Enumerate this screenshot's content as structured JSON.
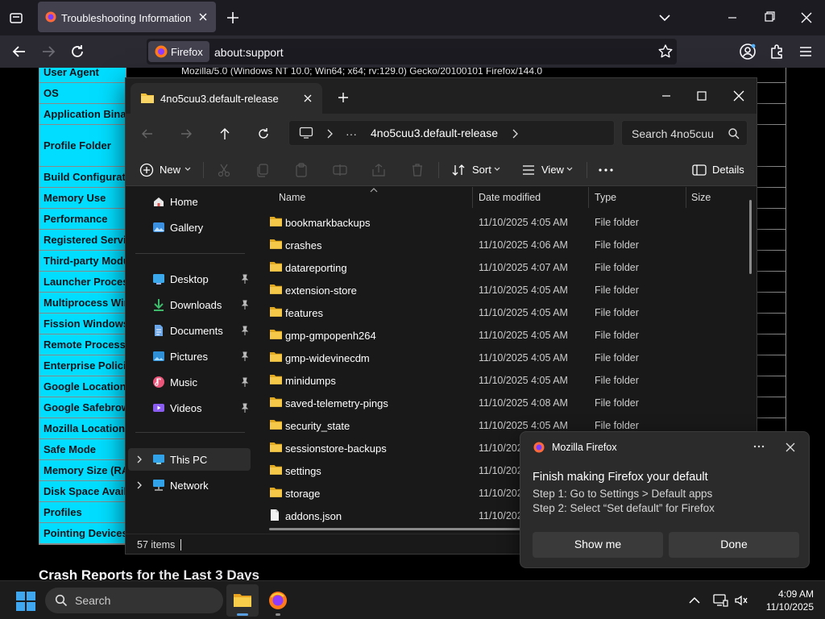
{
  "browser": {
    "tab_title": "Troubleshooting Information",
    "identity_label": "Firefox",
    "url": "about:support"
  },
  "support_page": {
    "row0_value": "Mozilla/5.0 (Windows NT 10.0; Win64; x64; rv:129.0) Gecko/20100101 Firefox/144.0",
    "rows": [
      "User Agent",
      "OS",
      "Application Binary",
      "Profile Folder",
      "Build Configuration",
      "Memory Use",
      "Performance",
      "Registered Service Workers",
      "Third-party Modules",
      "Launcher Process",
      "Multiprocess Windows",
      "Fission Windows",
      "Remote Processes",
      "Enterprise Policies",
      "Google Location Service Key",
      "Google Safebrowsing Key",
      "Mozilla Location Service Key",
      "Safe Mode",
      "Memory Size (RAM)",
      "Disk Space Available",
      "Profiles",
      "Pointing Devices"
    ],
    "crash_heading": "Crash Reports for the Last 3 Days"
  },
  "explorer": {
    "tab_title": "4no5cuu3.default-release",
    "breadcrumb_more": "···",
    "breadcrumb": "4no5cuu3.default-release",
    "search_placeholder": "Search 4no5cuu",
    "commands": {
      "new": "New",
      "sort": "Sort",
      "view": "View",
      "details": "Details"
    },
    "nav": {
      "home": "Home",
      "gallery": "Gallery",
      "desktop": "Desktop",
      "downloads": "Downloads",
      "documents": "Documents",
      "pictures": "Pictures",
      "music": "Music",
      "videos": "Videos",
      "this_pc": "This PC",
      "network": "Network"
    },
    "columns": {
      "name": "Name",
      "date": "Date modified",
      "type": "Type",
      "size": "Size"
    },
    "files": [
      {
        "name": "bookmarkbackups",
        "date": "11/10/2025 4:05 AM",
        "type": "File folder"
      },
      {
        "name": "crashes",
        "date": "11/10/2025 4:06 AM",
        "type": "File folder"
      },
      {
        "name": "datareporting",
        "date": "11/10/2025 4:07 AM",
        "type": "File folder"
      },
      {
        "name": "extension-store",
        "date": "11/10/2025 4:05 AM",
        "type": "File folder"
      },
      {
        "name": "features",
        "date": "11/10/2025 4:05 AM",
        "type": "File folder"
      },
      {
        "name": "gmp-gmpopenh264",
        "date": "11/10/2025 4:05 AM",
        "type": "File folder"
      },
      {
        "name": "gmp-widevinecdm",
        "date": "11/10/2025 4:05 AM",
        "type": "File folder"
      },
      {
        "name": "minidumps",
        "date": "11/10/2025 4:05 AM",
        "type": "File folder"
      },
      {
        "name": "saved-telemetry-pings",
        "date": "11/10/2025 4:08 AM",
        "type": "File folder"
      },
      {
        "name": "security_state",
        "date": "11/10/2025 4:05 AM",
        "type": "File folder"
      },
      {
        "name": "sessionstore-backups",
        "date": "11/10/202",
        "type": ""
      },
      {
        "name": "settings",
        "date": "11/10/202",
        "type": ""
      },
      {
        "name": "storage",
        "date": "11/10/202",
        "type": ""
      },
      {
        "name": "addons.json",
        "date": "11/10/202",
        "type": ""
      }
    ],
    "status": "57 items"
  },
  "notification": {
    "app": "Mozilla Firefox",
    "title": "Finish making Firefox your default",
    "line1": "Step 1: Go to Settings > Default apps",
    "line2": "Step 2: Select “Set default” for Firefox",
    "show_me": "Show me",
    "done": "Done"
  },
  "taskbar": {
    "search_placeholder": "Search",
    "time": "4:09 AM",
    "date": "11/10/2025"
  },
  "colors": {
    "support_header": "#00ddff",
    "folder": "#f3c13a",
    "firefox_bg": "#1c1b22",
    "toolbar": "#2b2a33"
  },
  "icons": [
    "tab-list-icon",
    "firefox-icon",
    "close-icon",
    "plus-icon",
    "chevron-down-icon",
    "minimize-icon",
    "maximize-icon",
    "back-icon",
    "forward-icon",
    "reload-icon",
    "star-icon",
    "account-icon",
    "extensions-icon",
    "menu-icon",
    "folder-icon",
    "up-arrow-icon",
    "refresh-icon",
    "monitor-icon",
    "chevron-right-icon",
    "search-icon",
    "cut-icon",
    "copy-icon",
    "paste-icon",
    "rename-icon",
    "share-icon",
    "delete-icon",
    "sort-icon",
    "view-icon",
    "more-icon",
    "details-icon",
    "home-icon",
    "gallery-icon",
    "desktop-icon",
    "downloads-icon",
    "documents-icon",
    "pictures-icon",
    "music-icon",
    "videos-icon",
    "pin-icon",
    "pc-icon",
    "network-icon",
    "file-icon",
    "windows-start-icon",
    "file-explorer-icon",
    "wifi-icon",
    "volume-icon"
  ]
}
